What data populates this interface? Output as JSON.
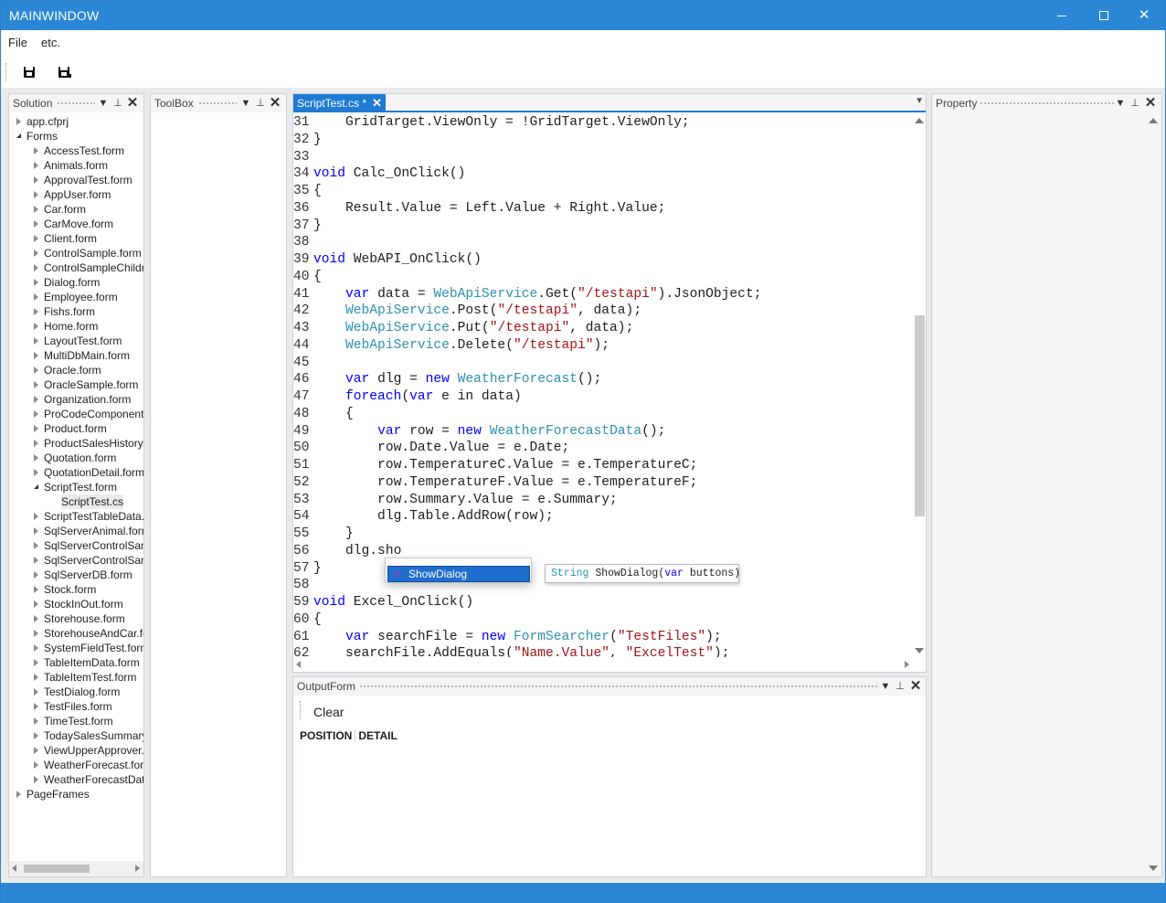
{
  "window": {
    "title": "MAINWINDOW"
  },
  "titlebar": {
    "min_icon": "minimize-icon",
    "max_icon": "maximize-icon",
    "close_glyph": "✕"
  },
  "menu": {
    "items": [
      "File",
      "etc."
    ]
  },
  "toolbar": {
    "buttons": [
      "save-icon",
      "save-all-icon"
    ]
  },
  "solution": {
    "title": "Solution",
    "tree": [
      {
        "label": "app.cfprj",
        "level": 0,
        "expander": "closed"
      },
      {
        "label": "Forms",
        "level": 0,
        "expander": "open"
      },
      {
        "label": "AccessTest.form",
        "level": 1,
        "expander": "closed"
      },
      {
        "label": "Animals.form",
        "level": 1,
        "expander": "closed"
      },
      {
        "label": "ApprovalTest.form",
        "level": 1,
        "expander": "closed"
      },
      {
        "label": "AppUser.form",
        "level": 1,
        "expander": "closed"
      },
      {
        "label": "Car.form",
        "level": 1,
        "expander": "closed"
      },
      {
        "label": "CarMove.form",
        "level": 1,
        "expander": "closed"
      },
      {
        "label": "Client.form",
        "level": 1,
        "expander": "closed"
      },
      {
        "label": "ControlSample.form",
        "level": 1,
        "expander": "closed"
      },
      {
        "label": "ControlSampleChildr",
        "level": 1,
        "expander": "closed"
      },
      {
        "label": "Dialog.form",
        "level": 1,
        "expander": "closed"
      },
      {
        "label": "Employee.form",
        "level": 1,
        "expander": "closed"
      },
      {
        "label": "Fishs.form",
        "level": 1,
        "expander": "closed"
      },
      {
        "label": "Home.form",
        "level": 1,
        "expander": "closed"
      },
      {
        "label": "LayoutTest.form",
        "level": 1,
        "expander": "closed"
      },
      {
        "label": "MultiDbMain.form",
        "level": 1,
        "expander": "closed"
      },
      {
        "label": "Oracle.form",
        "level": 1,
        "expander": "closed"
      },
      {
        "label": "OracleSample.form",
        "level": 1,
        "expander": "closed"
      },
      {
        "label": "Organization.form",
        "level": 1,
        "expander": "closed"
      },
      {
        "label": "ProCodeComponent",
        "level": 1,
        "expander": "closed"
      },
      {
        "label": "Product.form",
        "level": 1,
        "expander": "closed"
      },
      {
        "label": "ProductSalesHistory.f",
        "level": 1,
        "expander": "closed"
      },
      {
        "label": "Quotation.form",
        "level": 1,
        "expander": "closed"
      },
      {
        "label": "QuotationDetail.form",
        "level": 1,
        "expander": "closed"
      },
      {
        "label": "ScriptTest.form",
        "level": 1,
        "expander": "open"
      },
      {
        "label": "ScriptTest.cs",
        "level": 2,
        "expander": "none",
        "selected": true
      },
      {
        "label": "ScriptTestTableData.f",
        "level": 1,
        "expander": "closed"
      },
      {
        "label": "SqlServerAnimal.form",
        "level": 1,
        "expander": "closed"
      },
      {
        "label": "SqlServerControlSam",
        "level": 1,
        "expander": "closed"
      },
      {
        "label": "SqlServerControlSam",
        "level": 1,
        "expander": "closed"
      },
      {
        "label": "SqlServerDB.form",
        "level": 1,
        "expander": "closed"
      },
      {
        "label": "Stock.form",
        "level": 1,
        "expander": "closed"
      },
      {
        "label": "StockInOut.form",
        "level": 1,
        "expander": "closed"
      },
      {
        "label": "Storehouse.form",
        "level": 1,
        "expander": "closed"
      },
      {
        "label": "StorehouseAndCar.fo",
        "level": 1,
        "expander": "closed"
      },
      {
        "label": "SystemFieldTest.form",
        "level": 1,
        "expander": "closed"
      },
      {
        "label": "TableItemData.form",
        "level": 1,
        "expander": "closed"
      },
      {
        "label": "TableItemTest.form",
        "level": 1,
        "expander": "closed"
      },
      {
        "label": "TestDialog.form",
        "level": 1,
        "expander": "closed"
      },
      {
        "label": "TestFiles.form",
        "level": 1,
        "expander": "closed"
      },
      {
        "label": "TimeTest.form",
        "level": 1,
        "expander": "closed"
      },
      {
        "label": "TodaySalesSummary.",
        "level": 1,
        "expander": "closed"
      },
      {
        "label": "ViewUpperApprover.",
        "level": 1,
        "expander": "closed"
      },
      {
        "label": "WeatherForecast.forr",
        "level": 1,
        "expander": "closed"
      },
      {
        "label": "WeatherForecastData",
        "level": 1,
        "expander": "closed"
      },
      {
        "label": "PageFrames",
        "level": 0,
        "expander": "closed"
      }
    ]
  },
  "toolbox": {
    "title": "ToolBox"
  },
  "property": {
    "title": "Property"
  },
  "editor": {
    "tab_label": "ScriptTest.cs *",
    "tab_close": "✕",
    "lines": [
      {
        "n": "31",
        "tokens": [
          [
            "    GridTarget.ViewOnly = !GridTarget.ViewOnly;",
            ""
          ]
        ]
      },
      {
        "n": "32",
        "tokens": [
          [
            "}",
            ""
          ]
        ]
      },
      {
        "n": "33",
        "tokens": []
      },
      {
        "n": "34",
        "tokens": [
          [
            "void",
            "kw"
          ],
          [
            " Calc_OnClick()",
            ""
          ]
        ]
      },
      {
        "n": "35",
        "tokens": [
          [
            "{",
            ""
          ]
        ]
      },
      {
        "n": "36",
        "tokens": [
          [
            "    Result.Value = Left.Value + Right.Value;",
            ""
          ]
        ]
      },
      {
        "n": "37",
        "tokens": [
          [
            "}",
            ""
          ]
        ]
      },
      {
        "n": "38",
        "tokens": []
      },
      {
        "n": "39",
        "tokens": [
          [
            "void",
            "kw"
          ],
          [
            " WebAPI_OnClick()",
            ""
          ]
        ]
      },
      {
        "n": "40",
        "tokens": [
          [
            "{",
            ""
          ]
        ]
      },
      {
        "n": "41",
        "tokens": [
          [
            "    ",
            ""
          ],
          [
            "var",
            "kw"
          ],
          [
            " data = ",
            ""
          ],
          [
            "WebApiService",
            "ty"
          ],
          [
            ".Get(",
            ""
          ],
          [
            "\"/testapi\"",
            "st"
          ],
          [
            ").JsonObject;",
            ""
          ]
        ]
      },
      {
        "n": "42",
        "tokens": [
          [
            "    ",
            ""
          ],
          [
            "WebApiService",
            "ty"
          ],
          [
            ".Post(",
            ""
          ],
          [
            "\"/testapi\"",
            "st"
          ],
          [
            ", data);",
            ""
          ]
        ]
      },
      {
        "n": "43",
        "tokens": [
          [
            "    ",
            ""
          ],
          [
            "WebApiService",
            "ty"
          ],
          [
            ".Put(",
            ""
          ],
          [
            "\"/testapi\"",
            "st"
          ],
          [
            ", data);",
            ""
          ]
        ]
      },
      {
        "n": "44",
        "tokens": [
          [
            "    ",
            ""
          ],
          [
            "WebApiService",
            "ty"
          ],
          [
            ".Delete(",
            ""
          ],
          [
            "\"/testapi\"",
            "st"
          ],
          [
            ");",
            ""
          ]
        ]
      },
      {
        "n": "45",
        "tokens": []
      },
      {
        "n": "46",
        "tokens": [
          [
            "    ",
            ""
          ],
          [
            "var",
            "kw"
          ],
          [
            " dlg = ",
            ""
          ],
          [
            "new",
            "kw"
          ],
          [
            " ",
            ""
          ],
          [
            "WeatherForecast",
            "ty"
          ],
          [
            "();",
            ""
          ]
        ]
      },
      {
        "n": "47",
        "tokens": [
          [
            "    ",
            ""
          ],
          [
            "foreach",
            "kw"
          ],
          [
            "(",
            ""
          ],
          [
            "var",
            "kw"
          ],
          [
            " e in data)",
            ""
          ]
        ]
      },
      {
        "n": "48",
        "tokens": [
          [
            "    {",
            ""
          ]
        ]
      },
      {
        "n": "49",
        "tokens": [
          [
            "        ",
            ""
          ],
          [
            "var",
            "kw"
          ],
          [
            " row = ",
            ""
          ],
          [
            "new",
            "kw"
          ],
          [
            " ",
            ""
          ],
          [
            "WeatherForecastData",
            "ty"
          ],
          [
            "();",
            ""
          ]
        ]
      },
      {
        "n": "50",
        "tokens": [
          [
            "        row.Date.Value = e.Date;",
            ""
          ]
        ]
      },
      {
        "n": "51",
        "tokens": [
          [
            "        row.TemperatureC.Value = e.TemperatureC;",
            ""
          ]
        ]
      },
      {
        "n": "52",
        "tokens": [
          [
            "        row.TemperatureF.Value = e.TemperatureF;",
            ""
          ]
        ]
      },
      {
        "n": "53",
        "tokens": [
          [
            "        row.Summary.Value = e.Summary;",
            ""
          ]
        ]
      },
      {
        "n": "54",
        "tokens": [
          [
            "        dlg.Table.AddRow(row);",
            ""
          ]
        ]
      },
      {
        "n": "55",
        "tokens": [
          [
            "    }",
            ""
          ]
        ]
      },
      {
        "n": "56",
        "tokens": [
          [
            "    dlg.sho",
            ""
          ]
        ]
      },
      {
        "n": "57",
        "tokens": [
          [
            "}",
            ""
          ]
        ]
      },
      {
        "n": "58",
        "tokens": []
      },
      {
        "n": "59",
        "tokens": [
          [
            "void",
            "kw"
          ],
          [
            " Excel_OnClick()",
            ""
          ]
        ]
      },
      {
        "n": "60",
        "tokens": [
          [
            "{",
            ""
          ]
        ]
      },
      {
        "n": "61",
        "tokens": [
          [
            "    ",
            ""
          ],
          [
            "var",
            "kw"
          ],
          [
            " searchFile = ",
            ""
          ],
          [
            "new",
            "kw"
          ],
          [
            " ",
            ""
          ],
          [
            "FormSearcher",
            "ty"
          ],
          [
            "(",
            ""
          ],
          [
            "\"TestFiles\"",
            "st"
          ],
          [
            ");",
            ""
          ]
        ]
      },
      {
        "n": "62",
        "tokens": [
          [
            "    searchFile.AddEquals(",
            ""
          ],
          [
            "\"Name.Value\"",
            "st"
          ],
          [
            ", ",
            ""
          ],
          [
            "\"ExcelTest\"",
            "st"
          ],
          [
            ");",
            ""
          ]
        ]
      }
    ]
  },
  "completion": {
    "item": "ShowDialog",
    "tooltip": [
      [
        "String",
        "ty"
      ],
      [
        " ShowDialog(",
        ""
      ],
      [
        "var",
        "kw"
      ],
      [
        " buttons)",
        ""
      ]
    ]
  },
  "output": {
    "title": "OutputForm",
    "clear_label": "Clear",
    "columns": [
      "POSITION",
      "DETAIL"
    ]
  },
  "colors": {
    "accent": "#2b87d6",
    "keyword": "#0000ff",
    "type": "#2b91af",
    "string": "#a31515"
  }
}
